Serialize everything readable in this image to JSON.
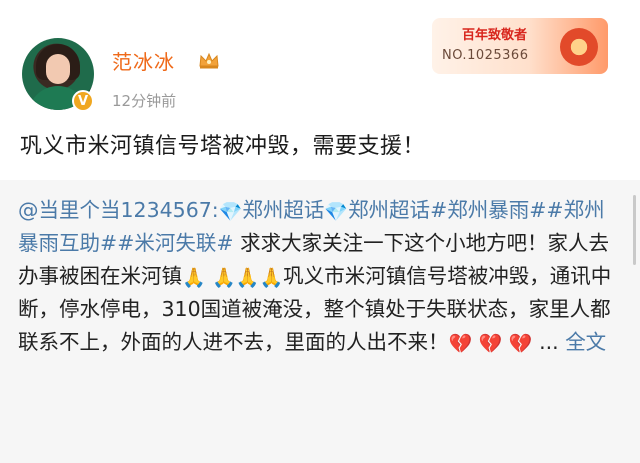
{
  "author": {
    "name": "范冰冰",
    "time": "12分钟前",
    "verified_icon": "v-badge-icon",
    "crown_icon": "crown-icon"
  },
  "medal": {
    "title": "百年致敬者",
    "number": "NO.1025366"
  },
  "post": {
    "text": "巩义市米河镇信号塔被冲毁，需要支援！"
  },
  "repost": {
    "mention": "@当里个当1234567:",
    "topic1": "郑州超话",
    "topic2": "郑州超话",
    "hashtag1": "#郑州暴雨#",
    "hashtag2": "#郑州暴雨互助#",
    "hashtag3": "#米河失联#",
    "text1": " 求求大家关注一下这个小地方吧！家人去办事被困在米河镇",
    "text2": "巩义市米河镇信号塔被冲毁，通讯中断，停水停电，310国道被淹没，整个镇处于失联状态，家里人都联系不上，外面的人进不去，里面的人出不来！",
    "ellipsis": " ...",
    "more_label": "全文",
    "praying_icon": "🙏",
    "broken_heart_icon": "💔",
    "diamond_icon": "💎"
  }
}
